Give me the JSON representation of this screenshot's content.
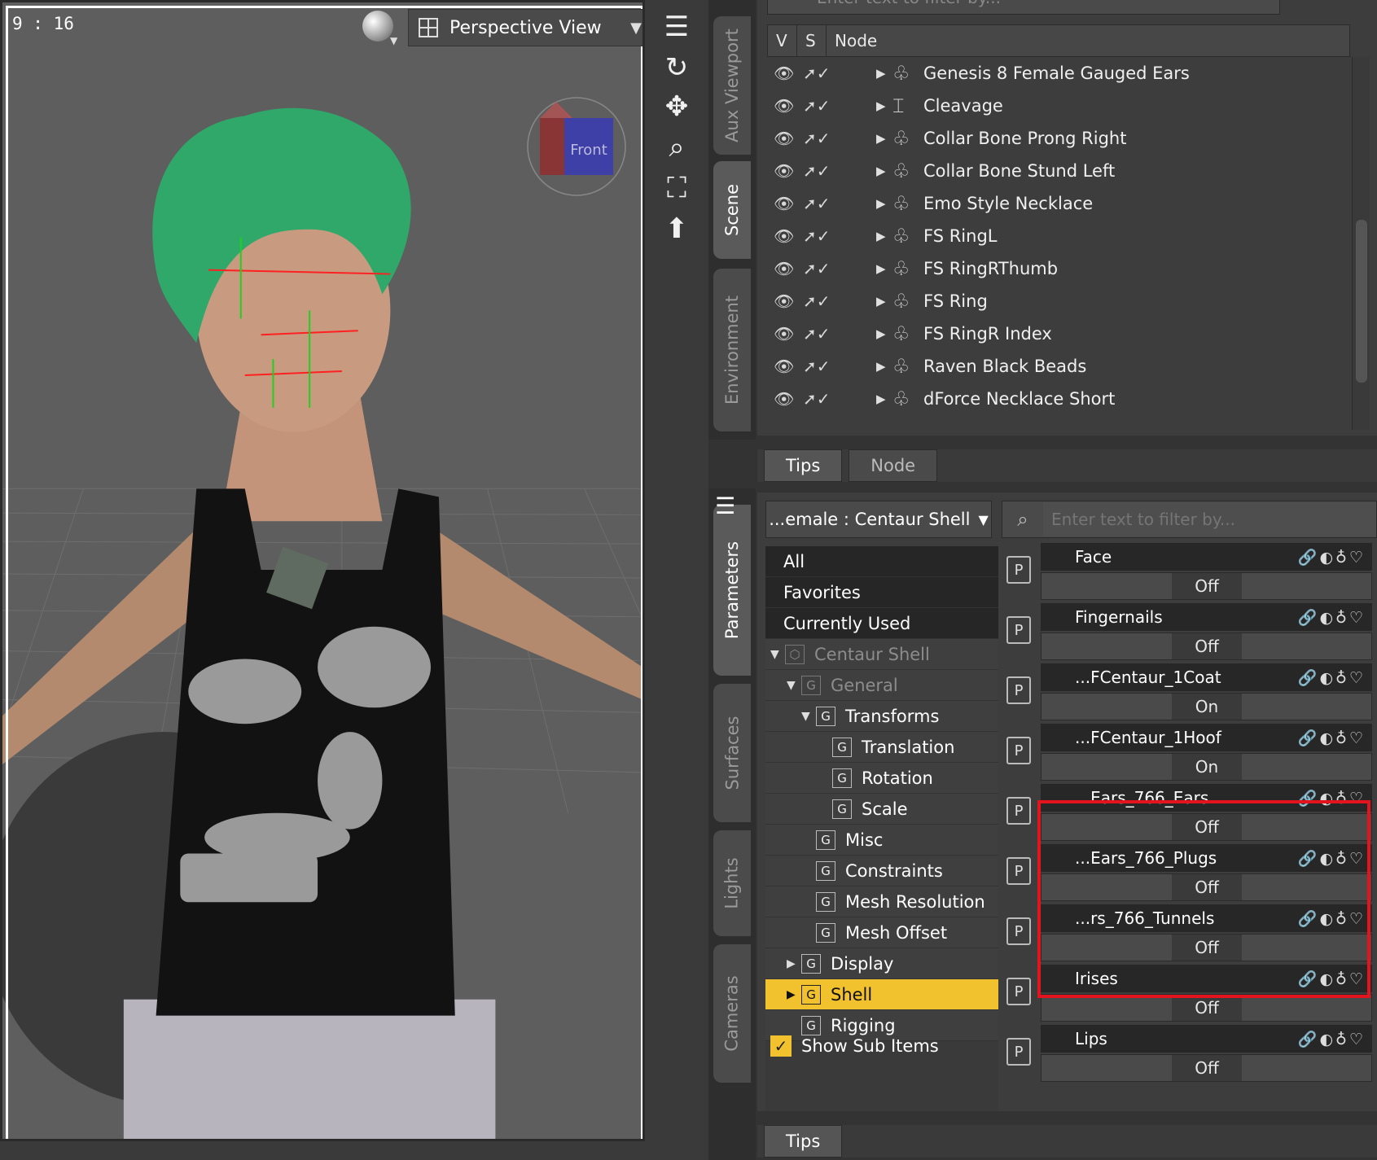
{
  "viewport": {
    "time": "9 : 16",
    "view_label": "Perspective View",
    "view_caret": "▼",
    "cube_face": "Front"
  },
  "scene_pane": {
    "filter_placeholder": "Enter text to filter by...",
    "columns": [
      "V",
      "S",
      "Node"
    ],
    "nodes": [
      "Genesis 8 Female Gauged Ears",
      "Cleavage",
      "Collar Bone Prong Right",
      "Collar Bone Stund Left",
      "Emo Style Necklace",
      "FS RingL",
      "FS RingRThumb",
      "FS Ring",
      "FS RingR Index",
      "Raven Black Beads",
      "dForce Necklace Short"
    ],
    "tabs": [
      "Tips",
      "Node"
    ]
  },
  "side_tabs_top": [
    "Aux Viewport",
    "Scene",
    "Environment"
  ],
  "side_tabs_bottom": [
    "Parameters",
    "Surfaces",
    "Lights",
    "Cameras"
  ],
  "parameters": {
    "node_selector": "...emale : Centaur Shell",
    "filter_placeholder": "Enter text to filter by...",
    "tree": [
      {
        "label": "All"
      },
      {
        "label": "Favorites"
      },
      {
        "label": "Currently Used"
      },
      {
        "label": "Centaur Shell"
      },
      {
        "label": "General"
      },
      {
        "label": "Transforms"
      },
      {
        "label": "Translation"
      },
      {
        "label": "Rotation"
      },
      {
        "label": "Scale"
      },
      {
        "label": "Misc"
      },
      {
        "label": "Constraints"
      },
      {
        "label": "Mesh Resolution"
      },
      {
        "label": "Mesh Offset"
      },
      {
        "label": "Display"
      },
      {
        "label": "Shell"
      },
      {
        "label": "Rigging"
      }
    ],
    "show_sub_items": "Show Sub Items",
    "properties": [
      {
        "name": "Face",
        "value": "Off"
      },
      {
        "name": "Fingernails",
        "value": "Off"
      },
      {
        "name": "...FCentaur_1Coat",
        "value": "On"
      },
      {
        "name": "...FCentaur_1Hoof",
        "value": "On"
      },
      {
        "name": "...Ears_766_Ears",
        "value": "Off"
      },
      {
        "name": "...Ears_766_Plugs",
        "value": "Off"
      },
      {
        "name": "...rs_766_Tunnels",
        "value": "Off"
      },
      {
        "name": "Irises",
        "value": "Off"
      },
      {
        "name": "Lips",
        "value": "Off"
      }
    ],
    "badge": "P",
    "tabs": [
      "Tips"
    ]
  },
  "colors": {
    "selected": "#f2c12e",
    "highlight_box": "#e3141e",
    "hair": "#2fa86a"
  }
}
